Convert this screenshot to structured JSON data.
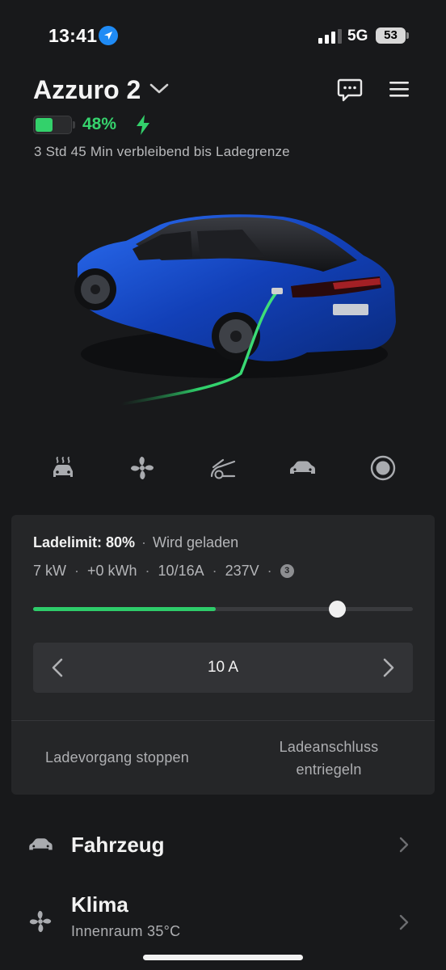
{
  "status_bar": {
    "time": "13:41",
    "network": "5G",
    "battery": "53"
  },
  "header": {
    "vehicle_name": "Azzuro 2",
    "battery_percent_label": "48%",
    "battery_level": 0.48,
    "remaining_text": "3 Std 45 Min verbleibend bis Ladegrenze"
  },
  "quick_controls": [
    {
      "name": "climate-heat-icon"
    },
    {
      "name": "fan-icon"
    },
    {
      "name": "charge-port-icon"
    },
    {
      "name": "car-icon"
    },
    {
      "name": "record-icon"
    }
  ],
  "charging": {
    "limit_label": "Ladelimit: 80%",
    "status": "Wird geladen",
    "power": "7 kW",
    "energy": "+0 kWh",
    "current_ratio": "10/16A",
    "voltage": "237V",
    "phases": "3",
    "charge_level": 0.48,
    "limit_level": 0.8,
    "amps_value": "10 A",
    "stop_button": "Ladevorgang stoppen",
    "unlock_button_line1": "Ladeanschluss",
    "unlock_button_line2": "entriegeln"
  },
  "menu": {
    "vehicle": {
      "title": "Fahrzeug"
    },
    "climate": {
      "title": "Klima",
      "subtitle": "Innenraum 35°C"
    }
  },
  "colors": {
    "background": "#18191b",
    "card": "#252628",
    "accent_green": "#33d16b",
    "car_blue": "#1a4fd0"
  }
}
